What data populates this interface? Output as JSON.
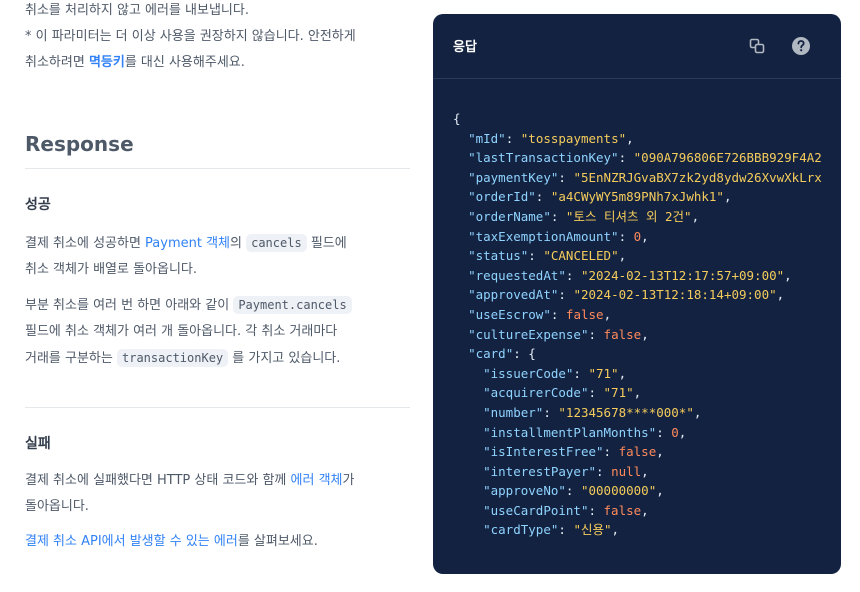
{
  "doc": {
    "intro": {
      "line1": "취소를 처리하지 않고 에러를 내보냅니다.",
      "line2": "* 이 파라미터는 더 이상 사용을 권장하지 않습니다. 안전하게",
      "line3_prefix": "취소하려면 ",
      "line3_link": "멱등키",
      "line3_suffix": "를 대신 사용해주세요."
    },
    "response_heading": "Response",
    "success": {
      "heading": "성공",
      "p1_a": "결제 취소에 성공하면 ",
      "p1_link": "Payment 객체",
      "p1_b": "의 ",
      "p1_code": "cancels",
      "p1_c": " 필드에",
      "p1_d": "취소 객체가 배열로 돌아옵니다.",
      "p2_a": "부분 취소를 여러 번 하면 아래와 같이 ",
      "p2_code": "Payment.cancels",
      "p2_b": "필드에 취소 객체가 여러 개 돌아옵니다. 각 취소 거래마다",
      "p2_c": "거래를 구분하는 ",
      "p2_code2": "transactionKey",
      "p2_d": " 를 가지고 있습니다."
    },
    "failure": {
      "heading": "실패",
      "p1_a": "결제 취소에 실패했다면 HTTP 상태 코드와 함께 ",
      "p1_link": "에러 객체",
      "p1_b": "가",
      "p1_c": "돌아옵니다.",
      "p2_link": "결제 취소 API에서 발생할 수 있는 에러",
      "p2_b": "를 살펴보세요."
    }
  },
  "panel": {
    "title": "응답",
    "icons": [
      "copy-icon",
      "help-icon"
    ],
    "colors": {
      "bg": "#132240",
      "key": "#8fd3ff",
      "string": "#f5cc5c",
      "boolean": "#ff8a5c"
    },
    "code_lines": [
      {
        "indent": 0,
        "punct": "{"
      },
      {
        "indent": 1,
        "key": "mId",
        "value": "\"tosspayments\"",
        "type": "s",
        "comma": true
      },
      {
        "indent": 1,
        "key": "lastTransactionKey",
        "value": "\"090A796806E726BBB929F4A2",
        "type": "s",
        "comma": false
      },
      {
        "indent": 1,
        "key": "paymentKey",
        "value": "\"5EnNZRJGvaBX7zk2yd8ydw26XvwXkLrx",
        "type": "s",
        "comma": false
      },
      {
        "indent": 1,
        "key": "orderId",
        "value": "\"a4CWyWY5m89PNh7xJwhk1\"",
        "type": "s",
        "comma": true
      },
      {
        "indent": 1,
        "key": "orderName",
        "value": "\"토스 티셔츠 외 2건\"",
        "type": "s",
        "comma": true
      },
      {
        "indent": 1,
        "key": "taxExemptionAmount",
        "value": "0",
        "type": "b",
        "comma": true
      },
      {
        "indent": 1,
        "key": "status",
        "value": "\"CANCELED\"",
        "type": "s",
        "comma": true
      },
      {
        "indent": 1,
        "key": "requestedAt",
        "value": "\"2024-02-13T12:17:57+09:00\"",
        "type": "s",
        "comma": true
      },
      {
        "indent": 1,
        "key": "approvedAt",
        "value": "\"2024-02-13T12:18:14+09:00\"",
        "type": "s",
        "comma": true
      },
      {
        "indent": 1,
        "key": "useEscrow",
        "value": "false",
        "type": "b",
        "comma": true
      },
      {
        "indent": 1,
        "key": "cultureExpense",
        "value": "false",
        "type": "b",
        "comma": true
      },
      {
        "indent": 1,
        "key": "card",
        "value": "{",
        "type": "pn",
        "comma": false
      },
      {
        "indent": 2,
        "key": "issuerCode",
        "value": "\"71\"",
        "type": "s",
        "comma": true
      },
      {
        "indent": 2,
        "key": "acquirerCode",
        "value": "\"71\"",
        "type": "s",
        "comma": true
      },
      {
        "indent": 2,
        "key": "number",
        "value": "\"12345678****000*\"",
        "type": "s",
        "comma": true
      },
      {
        "indent": 2,
        "key": "installmentPlanMonths",
        "value": "0",
        "type": "b",
        "comma": true
      },
      {
        "indent": 2,
        "key": "isInterestFree",
        "value": "false",
        "type": "b",
        "comma": true
      },
      {
        "indent": 2,
        "key": "interestPayer",
        "value": "null",
        "type": "b",
        "comma": true
      },
      {
        "indent": 2,
        "key": "approveNo",
        "value": "\"00000000\"",
        "type": "s",
        "comma": true
      },
      {
        "indent": 2,
        "key": "useCardPoint",
        "value": "false",
        "type": "b",
        "comma": true
      },
      {
        "indent": 2,
        "key": "cardType",
        "value": "\"신용\"",
        "type": "s",
        "comma": true
      }
    ]
  }
}
